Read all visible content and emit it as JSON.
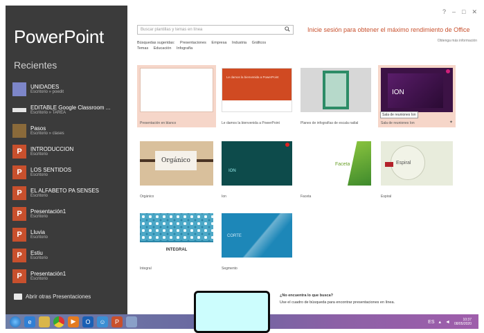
{
  "app": {
    "title": "PowerPoint",
    "recent_heading": "Recientes",
    "open_other": "Abrir otras Presentaciones"
  },
  "window_controls": [
    "?",
    "–",
    "□",
    "✕"
  ],
  "recent": [
    {
      "name": "UNIDADES",
      "path": "Escritorio » poedit",
      "icon": "blue"
    },
    {
      "name": "EDITABLE Google Classroom ...",
      "path": "Escritorio » TAREA",
      "icon": "white"
    },
    {
      "name": "Pasos",
      "path": "Escritorio » clases",
      "icon": "photo"
    },
    {
      "name": "INTRODUCCION",
      "path": "Escritorio",
      "icon": "ppt"
    },
    {
      "name": "LOS SENTIDOS",
      "path": "Escritorio",
      "icon": "ppt"
    },
    {
      "name": "EL ALFABETO PA SENSES",
      "path": "Escritorio",
      "icon": "ppt"
    },
    {
      "name": "Presentación1",
      "path": "Escritorio",
      "icon": "ppt"
    },
    {
      "name": "Lluvia",
      "path": "Escritorio",
      "icon": "ppt"
    },
    {
      "name": "Estiu",
      "path": "Escritorio",
      "icon": "ppt"
    },
    {
      "name": "Presentación1",
      "path": "Escritorio",
      "icon": "ppt"
    }
  ],
  "search": {
    "placeholder": "Buscar plantillas y temas en línea"
  },
  "suggestions": {
    "label": "Búsquedas sugeridas:",
    "items": [
      "Presentaciones",
      "Empresa",
      "Industria",
      "Gráficos",
      "Temas",
      "Educación",
      "Infografía"
    ]
  },
  "signin_banner": "Inicie sesión para obtener el máximo rendimiento de Office",
  "more_info": "Obtenga más información",
  "templates": [
    {
      "id": "blank",
      "caption": "Presentación en blanco"
    },
    {
      "id": "welcome",
      "caption": "Le damos la bienvenida a PowerPoint",
      "band_text": "Le damos la bienvenida a PowerPoint"
    },
    {
      "id": "infographic",
      "caption": "Planes de infografías de escala radial"
    },
    {
      "id": "ion-purple",
      "caption": "Sala de reuniones Ion",
      "thumb_text": "ION",
      "tooltip": "Sala de reuniones Ion"
    },
    {
      "id": "organico",
      "caption": "Orgánico",
      "thumb_text": "Orgánico"
    },
    {
      "id": "ion-teal",
      "caption": "Ion",
      "thumb_text": "ION"
    },
    {
      "id": "faceta",
      "caption": "Faceta",
      "thumb_text": "Faceta"
    },
    {
      "id": "espiral",
      "caption": "Espiral",
      "thumb_text": "Espiral"
    },
    {
      "id": "retrospect",
      "caption": "Integral",
      "thumb_text": "INTEGRAL"
    },
    {
      "id": "segment",
      "caption": "Segmento",
      "thumb_text": "CORTE"
    }
  ],
  "notice": {
    "title": "¿No encuentra lo que busca?",
    "body": "Use el cuadro de búsqueda para encontrar presentaciones en línea."
  },
  "taskbar": {
    "tray": "ES",
    "time": "10:37",
    "date": "08/05/2020"
  }
}
